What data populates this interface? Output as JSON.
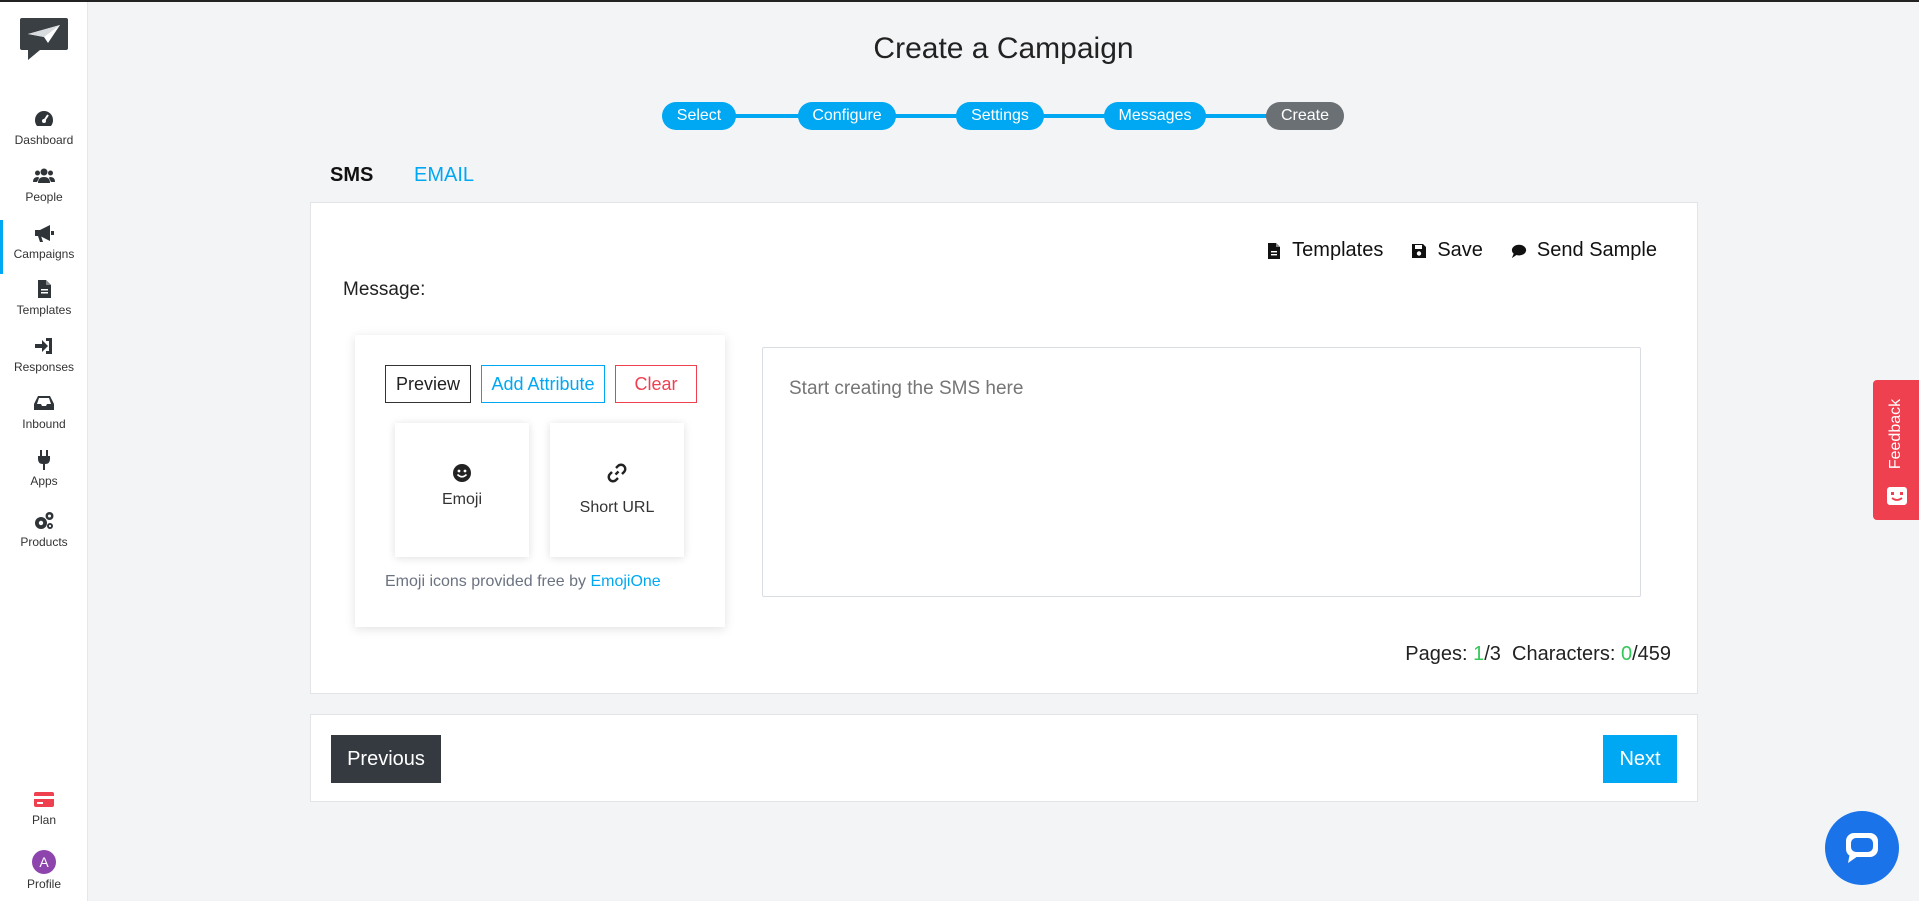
{
  "sidebar": {
    "items": [
      {
        "label": "Dashboard",
        "icon": "dashboard-icon"
      },
      {
        "label": "People",
        "icon": "people-icon"
      },
      {
        "label": "Campaigns",
        "icon": "megaphone-icon",
        "active": true
      },
      {
        "label": "Templates",
        "icon": "file-icon"
      },
      {
        "label": "Responses",
        "icon": "sign-in-icon"
      },
      {
        "label": "Inbound",
        "icon": "inbox-icon"
      },
      {
        "label": "Apps",
        "icon": "plug-icon"
      },
      {
        "label": "Products",
        "icon": "cogs-icon"
      }
    ],
    "plan_label": "Plan",
    "profile_label": "Profile",
    "profile_initial": "A"
  },
  "page": {
    "title": "Create a Campaign"
  },
  "stepper": {
    "steps": [
      "Select",
      "Configure",
      "Settings",
      "Messages",
      "Create"
    ],
    "current_index": 4
  },
  "tabs": {
    "sms": "SMS",
    "email": "EMAIL"
  },
  "actions": {
    "templates": "Templates",
    "save": "Save",
    "send_sample": "Send Sample"
  },
  "message": {
    "label": "Message:",
    "placeholder": "Start creating the SMS here"
  },
  "toolbox": {
    "preview": "Preview",
    "add_attribute": "Add Attribute",
    "clear": "Clear",
    "emoji": "Emoji",
    "short_url": "Short URL",
    "credit_text": "Emoji icons provided free by",
    "credit_link": "EmojiOne"
  },
  "counter": {
    "pages_label": "Pages:",
    "pages_current": "1",
    "pages_total": "/3",
    "chars_label": "Characters:",
    "chars_current": "0",
    "chars_total": "/459"
  },
  "footer": {
    "previous": "Previous",
    "next": "Next"
  },
  "feedback": {
    "label": "Feedback"
  },
  "colors": {
    "accent": "#00a8f3",
    "danger": "#ef4050",
    "success": "#34c759",
    "dark": "#343a40"
  }
}
